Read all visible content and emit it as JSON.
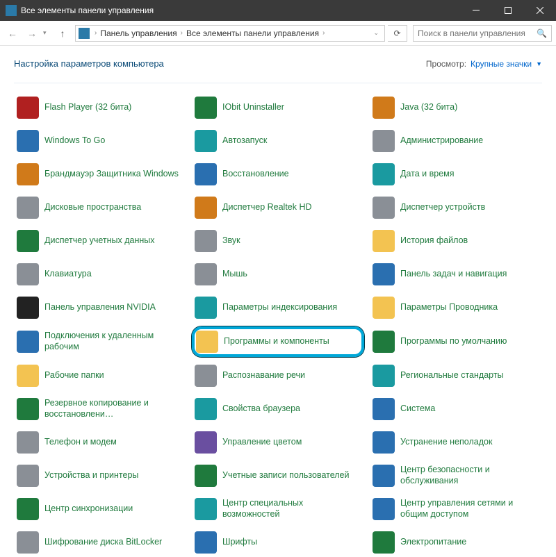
{
  "window": {
    "title": "Все элементы панели управления"
  },
  "breadcrumb": {
    "part1": "Панель управления",
    "part2": "Все элементы панели управления"
  },
  "search": {
    "placeholder": "Поиск в панели управления"
  },
  "header": {
    "title": "Настройка параметров компьютера",
    "view_label": "Просмотр:",
    "view_value": "Крупные значки"
  },
  "items": [
    {
      "label": "Flash Player (32 бита)",
      "cls": "ic-red"
    },
    {
      "label": "IObit Uninstaller",
      "cls": "ic-green"
    },
    {
      "label": "Java (32 бита)",
      "cls": "ic-orange"
    },
    {
      "label": "Windows To Go",
      "cls": "ic-blue"
    },
    {
      "label": "Автозапуск",
      "cls": "ic-teal"
    },
    {
      "label": "Администрирование",
      "cls": "ic-grey"
    },
    {
      "label": "Брандмауэр Защитника Windows",
      "cls": "ic-orange"
    },
    {
      "label": "Восстановление",
      "cls": "ic-blue"
    },
    {
      "label": "Дата и время",
      "cls": "ic-teal"
    },
    {
      "label": "Дисковые пространства",
      "cls": "ic-grey"
    },
    {
      "label": "Диспетчер Realtek HD",
      "cls": "ic-orange"
    },
    {
      "label": "Диспетчер устройств",
      "cls": "ic-grey"
    },
    {
      "label": "Диспетчер учетных данных",
      "cls": "ic-green"
    },
    {
      "label": "Звук",
      "cls": "ic-grey"
    },
    {
      "label": "История файлов",
      "cls": "ic-folder"
    },
    {
      "label": "Клавиатура",
      "cls": "ic-grey"
    },
    {
      "label": "Мышь",
      "cls": "ic-grey"
    },
    {
      "label": "Панель задач и навигация",
      "cls": "ic-blue"
    },
    {
      "label": "Панель управления NVIDIA",
      "cls": "ic-black"
    },
    {
      "label": "Параметры индексирования",
      "cls": "ic-teal"
    },
    {
      "label": "Параметры Проводника",
      "cls": "ic-folder"
    },
    {
      "label": "Подключения к удаленным рабочим",
      "cls": "ic-blue"
    },
    {
      "label": "Программы и компоненты",
      "cls": "ic-folder",
      "highlight": true
    },
    {
      "label": "Программы по умолчанию",
      "cls": "ic-green"
    },
    {
      "label": "Рабочие папки",
      "cls": "ic-folder"
    },
    {
      "label": "Распознавание речи",
      "cls": "ic-grey"
    },
    {
      "label": "Региональные стандарты",
      "cls": "ic-teal"
    },
    {
      "label": "Резервное копирование и восстановлени…",
      "cls": "ic-green"
    },
    {
      "label": "Свойства браузера",
      "cls": "ic-teal"
    },
    {
      "label": "Система",
      "cls": "ic-blue"
    },
    {
      "label": "Телефон и модем",
      "cls": "ic-grey"
    },
    {
      "label": "Управление цветом",
      "cls": "ic-purple"
    },
    {
      "label": "Устранение неполадок",
      "cls": "ic-blue"
    },
    {
      "label": "Устройства и принтеры",
      "cls": "ic-grey"
    },
    {
      "label": "Учетные записи пользователей",
      "cls": "ic-green"
    },
    {
      "label": "Центр безопасности и обслуживания",
      "cls": "ic-blue"
    },
    {
      "label": "Центр синхронизации",
      "cls": "ic-green"
    },
    {
      "label": "Центр специальных возможностей",
      "cls": "ic-teal"
    },
    {
      "label": "Центр управления сетями и общим доступом",
      "cls": "ic-blue"
    },
    {
      "label": "Шифрование диска BitLocker",
      "cls": "ic-grey"
    },
    {
      "label": "Шрифты",
      "cls": "ic-blue"
    },
    {
      "label": "Электропитание",
      "cls": "ic-green"
    }
  ]
}
